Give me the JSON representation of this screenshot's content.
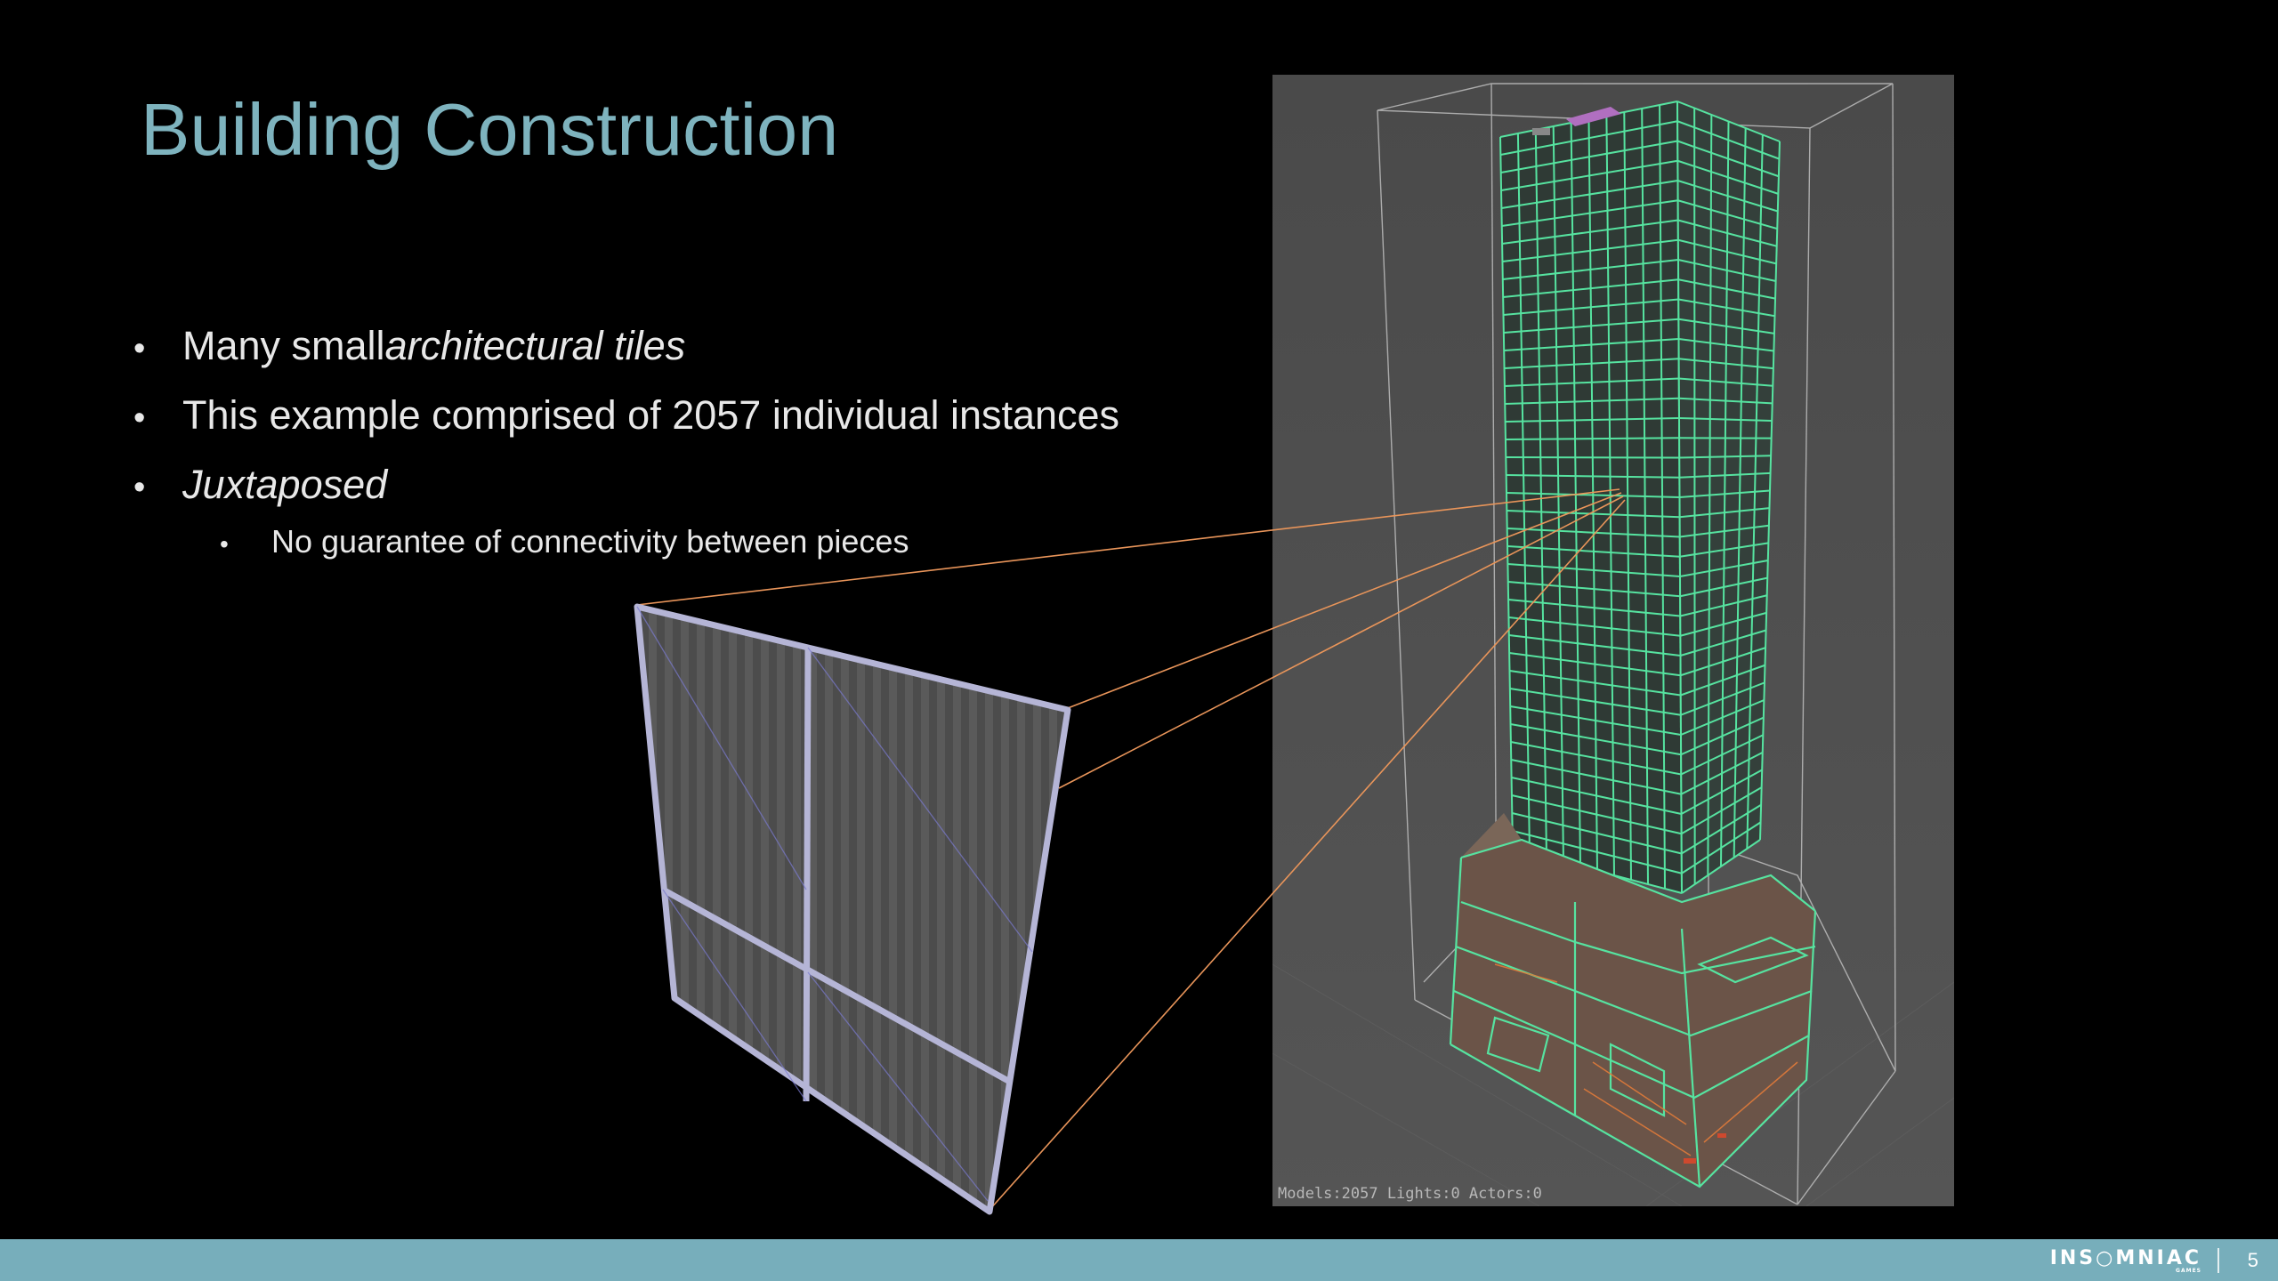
{
  "slide": {
    "title": "Building Construction",
    "bullets": [
      {
        "level": 1,
        "parts": [
          {
            "text": "Many small ",
            "italic": false
          },
          {
            "text": "architectural tiles",
            "italic": true
          }
        ]
      },
      {
        "level": 1,
        "parts": [
          {
            "text": "This example comprised of 2057 individual instances",
            "italic": false
          }
        ]
      },
      {
        "level": 1,
        "parts": [
          {
            "text": "Juxtaposed",
            "italic": true
          }
        ]
      },
      {
        "level": 2,
        "parts": [
          {
            "text": "No guarantee of connectivity between pieces",
            "italic": false
          }
        ]
      }
    ],
    "bullet_glyph": "•"
  },
  "viewport": {
    "hud": "Models:2057 Lights:0 Actors:0",
    "colors": {
      "background": "#4a4a4a",
      "wire": "#56e3a0",
      "bounds": "#bdbdbd",
      "callout": "#e9955a"
    }
  },
  "footer": {
    "logo": "INS○MNIAC",
    "logo_sub": "GAMES",
    "page_number": "5",
    "color": "#77aebb"
  },
  "colors": {
    "title": "#7eb3be",
    "text": "#e8e8e8",
    "background": "#000000"
  }
}
